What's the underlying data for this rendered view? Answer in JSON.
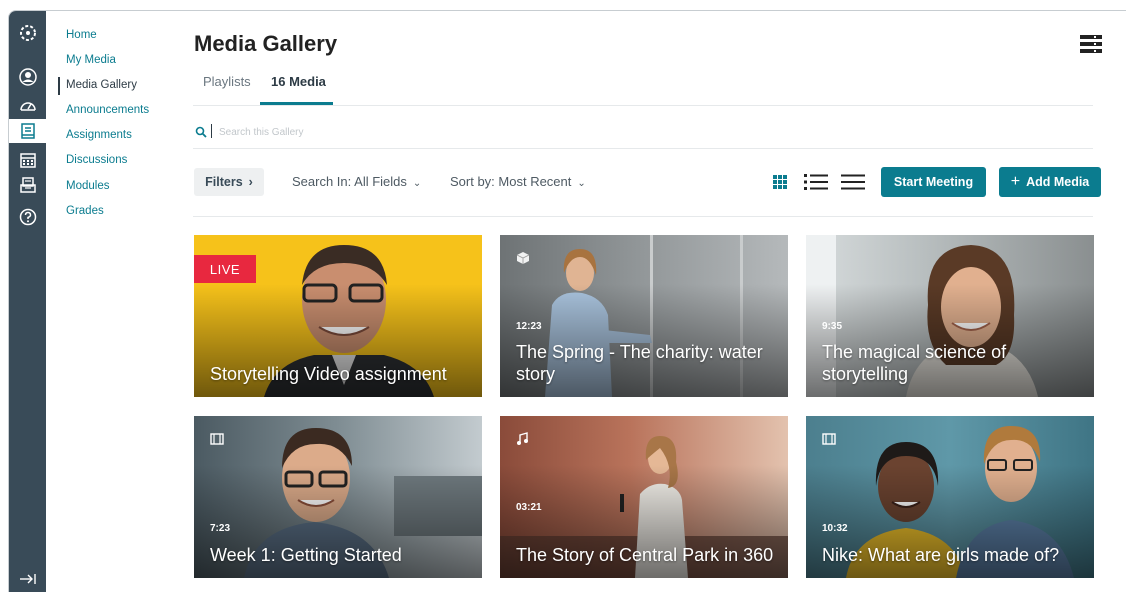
{
  "global_nav": {
    "items": [
      {
        "icon": "logo-icon"
      },
      {
        "icon": "account-icon"
      },
      {
        "icon": "dashboard-icon"
      },
      {
        "icon": "courses-icon",
        "active": true
      },
      {
        "icon": "calendar-icon"
      },
      {
        "icon": "inbox-icon"
      },
      {
        "icon": "help-icon"
      }
    ],
    "collapse_icon": "collapse-arrow-icon"
  },
  "course_nav": {
    "items": [
      {
        "label": "Home"
      },
      {
        "label": "My Media"
      },
      {
        "label": "Media Gallery",
        "active": true
      },
      {
        "label": "Announcements"
      },
      {
        "label": "Assignments"
      },
      {
        "label": "Discussions"
      },
      {
        "label": "Modules"
      },
      {
        "label": "Grades"
      }
    ]
  },
  "header": {
    "title": "Media Gallery",
    "menu_icon": "list-menu-icon"
  },
  "tabs": [
    {
      "label": "Playlists"
    },
    {
      "label": "16 Media",
      "active": true
    }
  ],
  "search": {
    "placeholder": "Search this Gallery"
  },
  "toolbar": {
    "filters_label": "Filters",
    "search_in_label": "Search In: All Fields",
    "sort_label": "Sort by: Most Recent",
    "start_meeting_label": "Start Meeting",
    "add_media_label": "Add Media",
    "add_icon": "+"
  },
  "cards": [
    {
      "title": "Storytelling Video assignment",
      "badge": "LIVE",
      "duration": ""
    },
    {
      "title": "The Spring - The charity: water story",
      "duration": "12:23",
      "type_icon": "cube-icon"
    },
    {
      "title": "The magical science of storytelling",
      "duration": "9:35"
    },
    {
      "title": "Week 1: Getting Started",
      "duration": "7:23",
      "type_icon": "film-icon"
    },
    {
      "title": "The Story of Central Park in 360",
      "duration": "03:21",
      "type_icon": "music-icon"
    },
    {
      "title": "Nike: What are girls made of?",
      "duration": "10:32",
      "type_icon": "film-icon"
    }
  ],
  "colors": {
    "accent": "#0b7c8f",
    "nav_bg": "#394b58",
    "live_red": "#e8283f",
    "card0_bg": "#f6c21a"
  }
}
